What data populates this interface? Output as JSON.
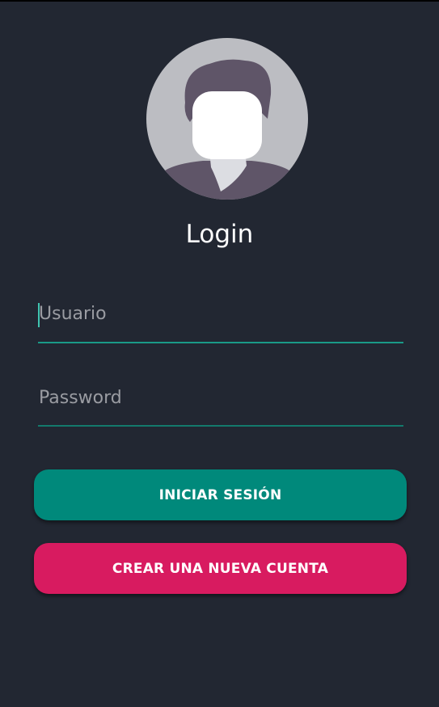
{
  "header": {
    "title": "Login"
  },
  "avatar": {
    "icon": "user-avatar-icon",
    "circle_color": "#bcbdc2",
    "hair_color": "#5f5568",
    "face_color": "#ffffff"
  },
  "form": {
    "username": {
      "placeholder": "Usuario",
      "value": ""
    },
    "password": {
      "placeholder": "Password",
      "value": ""
    }
  },
  "buttons": {
    "login_label": "INICIAR SESIÓN",
    "create_account_label": "CREAR UNA NUEVA CUENTA"
  },
  "colors": {
    "background": "#222732",
    "primary": "#00897b",
    "accent": "#d81b60",
    "underline": "#1a9a88"
  }
}
